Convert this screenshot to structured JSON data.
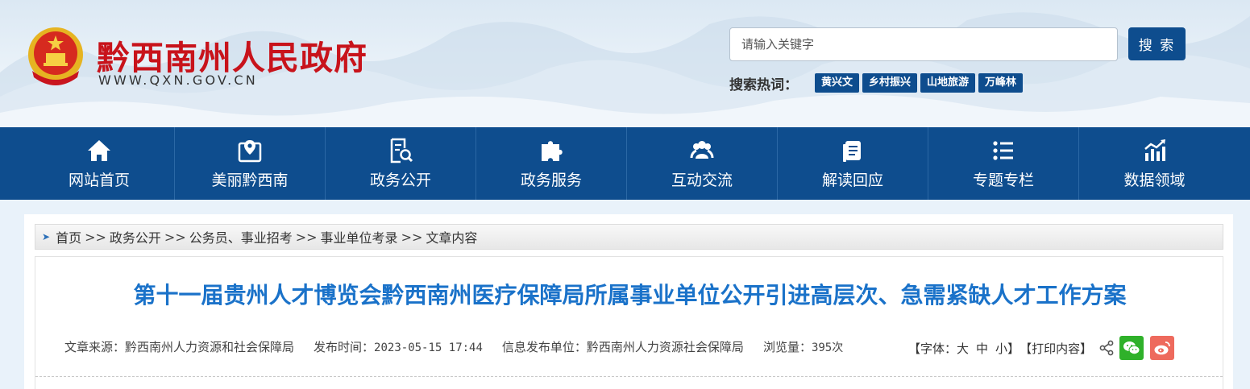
{
  "header": {
    "site_name": "黔西南州人民政府",
    "site_url": "WWW.QXN.GOV.CN",
    "search": {
      "placeholder": "请输入关键字",
      "button_label": "搜 索"
    },
    "hot_label": "搜索热词：",
    "hot_tags": [
      "黄兴文",
      "乡村振兴",
      "山地旅游",
      "万峰林"
    ]
  },
  "nav": {
    "items": [
      {
        "label": "网站首页",
        "icon": "home-icon"
      },
      {
        "label": "美丽黔西南",
        "icon": "map-location-icon"
      },
      {
        "label": "政务公开",
        "icon": "document-search-icon"
      },
      {
        "label": "政务服务",
        "icon": "puzzle-icon"
      },
      {
        "label": "互动交流",
        "icon": "people-icon"
      },
      {
        "label": "解读回应",
        "icon": "notes-icon"
      },
      {
        "label": "专题专栏",
        "icon": "list-icon"
      },
      {
        "label": "数据领域",
        "icon": "chart-icon"
      }
    ]
  },
  "breadcrumb": [
    "首页",
    "政务公开",
    "公务员、事业招考",
    "事业单位考录",
    "文章内容"
  ],
  "breadcrumb_sep": ">>",
  "article": {
    "title": "第十一届贵州人才博览会黔西南州医疗保障局所属事业单位公开引进高层次、急需紧缺人才工作方案",
    "source_label": "文章来源：",
    "source": "黔西南州人力资源和社会保障局",
    "time_label": "发布时间：",
    "time": "2023-05-15 17:44",
    "publisher_label": "信息发布单位：",
    "publisher": "黔西南州人力资源社会保障局",
    "views_label": "浏览量：",
    "views": "395次"
  },
  "tools": {
    "font_open": "【字体：",
    "font_large": "大",
    "font_medium": "中",
    "font_small": "小",
    "font_close": "】",
    "print": "【打印内容】"
  },
  "colors": {
    "primary": "#0e4d8e",
    "title": "#1a72c9",
    "site_name": "#c8131b"
  }
}
